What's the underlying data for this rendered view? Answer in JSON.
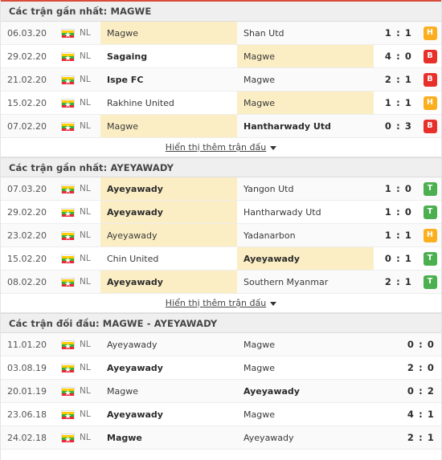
{
  "theme": {
    "accent_bar": "#d94b3a",
    "header_bg": "#efefef",
    "highlight": "#fbeec4",
    "badge_win": "#4caf50",
    "badge_draw": "#fcaf1e",
    "badge_loss": "#e8302a"
  },
  "flag_icon": "myanmar-flag-icon",
  "league_code": "NL",
  "show_more_label": "Hiển thị thêm trận đấu",
  "sections": [
    {
      "id": "recent-magwe",
      "title": "Các trận gần nhất: MAGWE",
      "has_badges": true,
      "has_more": true,
      "matches": [
        {
          "date": "06.03.20",
          "league": "NL",
          "home": "Magwe",
          "away": "Shan Utd",
          "home_hl": true,
          "away_hl": false,
          "home_bold": false,
          "away_bold": false,
          "score": "1 : 1",
          "badge": "H"
        },
        {
          "date": "29.02.20",
          "league": "NL",
          "home": "Sagaing",
          "away": "Magwe",
          "home_hl": false,
          "away_hl": true,
          "home_bold": true,
          "away_bold": false,
          "score": "4 : 0",
          "badge": "B"
        },
        {
          "date": "21.02.20",
          "league": "NL",
          "home": "Ispe FC",
          "away": "Magwe",
          "home_hl": false,
          "away_hl": false,
          "home_bold": true,
          "away_bold": false,
          "score": "2 : 1",
          "badge": "B"
        },
        {
          "date": "15.02.20",
          "league": "NL",
          "home": "Rakhine United",
          "away": "Magwe",
          "home_hl": false,
          "away_hl": true,
          "home_bold": false,
          "away_bold": false,
          "score": "1 : 1",
          "badge": "H"
        },
        {
          "date": "07.02.20",
          "league": "NL",
          "home": "Magwe",
          "away": "Hantharwady Utd",
          "home_hl": true,
          "away_hl": false,
          "home_bold": false,
          "away_bold": true,
          "score": "0 : 3",
          "badge": "B"
        }
      ]
    },
    {
      "id": "recent-ayeyawady",
      "title": "Các trận gần nhất: AYEYAWADY",
      "has_badges": true,
      "has_more": true,
      "matches": [
        {
          "date": "07.03.20",
          "league": "NL",
          "home": "Ayeyawady",
          "away": "Yangon Utd",
          "home_hl": true,
          "away_hl": false,
          "home_bold": true,
          "away_bold": false,
          "score": "1 : 0",
          "badge": "T"
        },
        {
          "date": "29.02.20",
          "league": "NL",
          "home": "Ayeyawady",
          "away": "Hantharwady Utd",
          "home_hl": true,
          "away_hl": false,
          "home_bold": true,
          "away_bold": false,
          "score": "1 : 0",
          "badge": "T"
        },
        {
          "date": "23.02.20",
          "league": "NL",
          "home": "Ayeyawady",
          "away": "Yadanarbon",
          "home_hl": true,
          "away_hl": false,
          "home_bold": false,
          "away_bold": false,
          "score": "1 : 1",
          "badge": "H"
        },
        {
          "date": "15.02.20",
          "league": "NL",
          "home": "Chin United",
          "away": "Ayeyawady",
          "home_hl": false,
          "away_hl": true,
          "home_bold": false,
          "away_bold": true,
          "score": "0 : 1",
          "badge": "T"
        },
        {
          "date": "08.02.20",
          "league": "NL",
          "home": "Ayeyawady",
          "away": "Southern Myanmar",
          "home_hl": true,
          "away_hl": false,
          "home_bold": true,
          "away_bold": false,
          "score": "2 : 1",
          "badge": "T"
        }
      ]
    },
    {
      "id": "head-to-head",
      "title": "Các trận đối đầu: MAGWE - AYEYAWADY",
      "has_badges": false,
      "has_more": false,
      "matches": [
        {
          "date": "11.01.20",
          "league": "NL",
          "home": "Ayeyawady",
          "away": "Magwe",
          "home_hl": false,
          "away_hl": false,
          "home_bold": false,
          "away_bold": false,
          "score": "0 : 0",
          "badge": ""
        },
        {
          "date": "03.08.19",
          "league": "NL",
          "home": "Ayeyawady",
          "away": "Magwe",
          "home_hl": false,
          "away_hl": false,
          "home_bold": true,
          "away_bold": false,
          "score": "2 : 0",
          "badge": ""
        },
        {
          "date": "20.01.19",
          "league": "NL",
          "home": "Magwe",
          "away": "Ayeyawady",
          "home_hl": false,
          "away_hl": false,
          "home_bold": false,
          "away_bold": true,
          "score": "0 : 2",
          "badge": ""
        },
        {
          "date": "23.06.18",
          "league": "NL",
          "home": "Ayeyawady",
          "away": "Magwe",
          "home_hl": false,
          "away_hl": false,
          "home_bold": true,
          "away_bold": false,
          "score": "4 : 1",
          "badge": ""
        },
        {
          "date": "24.02.18",
          "league": "NL",
          "home": "Magwe",
          "away": "Ayeyawady",
          "home_hl": false,
          "away_hl": false,
          "home_bold": true,
          "away_bold": false,
          "score": "2 : 1",
          "badge": ""
        }
      ]
    }
  ]
}
